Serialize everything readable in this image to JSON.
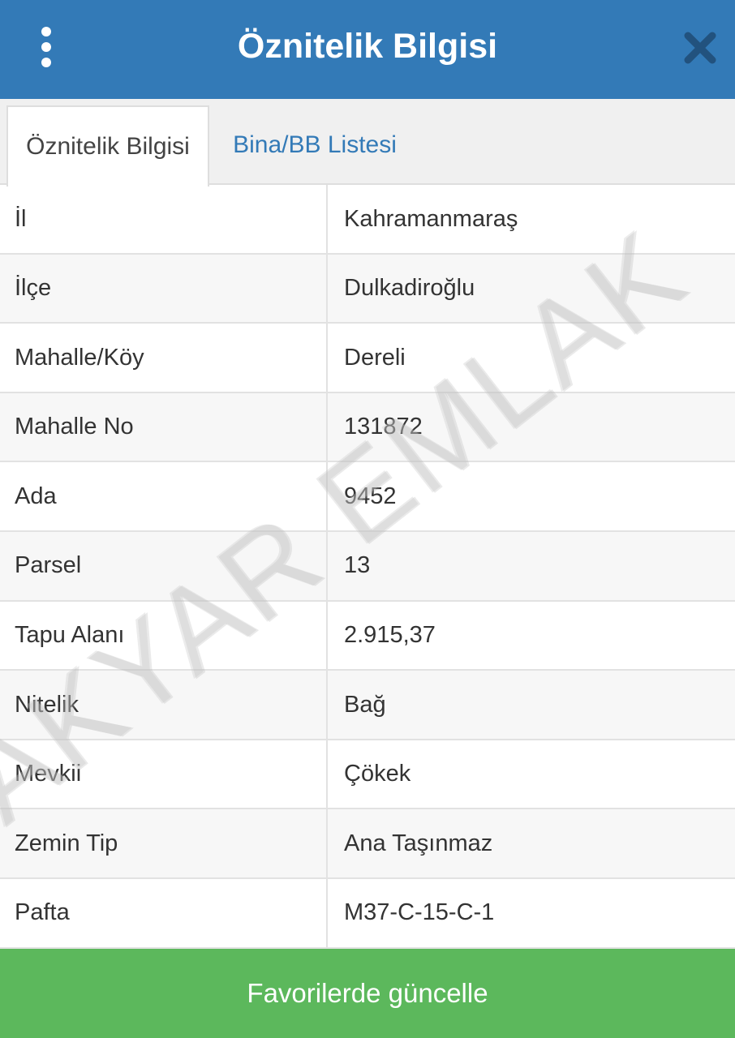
{
  "header": {
    "title": "Öznitelik Bilgisi",
    "bg_color": "#337ab7",
    "menu_icon": "kebab-menu-icon",
    "close_icon": "close-icon"
  },
  "tabs": [
    {
      "label": "Öznitelik Bilgisi",
      "active": true
    },
    {
      "label": "Bina/BB Listesi",
      "active": false
    }
  ],
  "rows": [
    {
      "label": "İl",
      "value": "Kahramanmaraş"
    },
    {
      "label": "İlçe",
      "value": "Dulkadiroğlu"
    },
    {
      "label": "Mahalle/Köy",
      "value": "Dereli"
    },
    {
      "label": "Mahalle No",
      "value": "131872"
    },
    {
      "label": "Ada",
      "value": "9452"
    },
    {
      "label": "Parsel",
      "value": "13"
    },
    {
      "label": "Tapu Alanı",
      "value": "2.915,37"
    },
    {
      "label": "Nitelik",
      "value": "Bağ"
    },
    {
      "label": "Mevkii",
      "value": "Çökek"
    },
    {
      "label": "Zemin Tip",
      "value": "Ana Taşınmaz"
    },
    {
      "label": "Pafta",
      "value": "M37-C-15-C-1"
    }
  ],
  "watermark": "AKYAR EMLAK",
  "footer": {
    "button_label": "Favorilerde güncelle",
    "button_color": "#5cb85c"
  }
}
